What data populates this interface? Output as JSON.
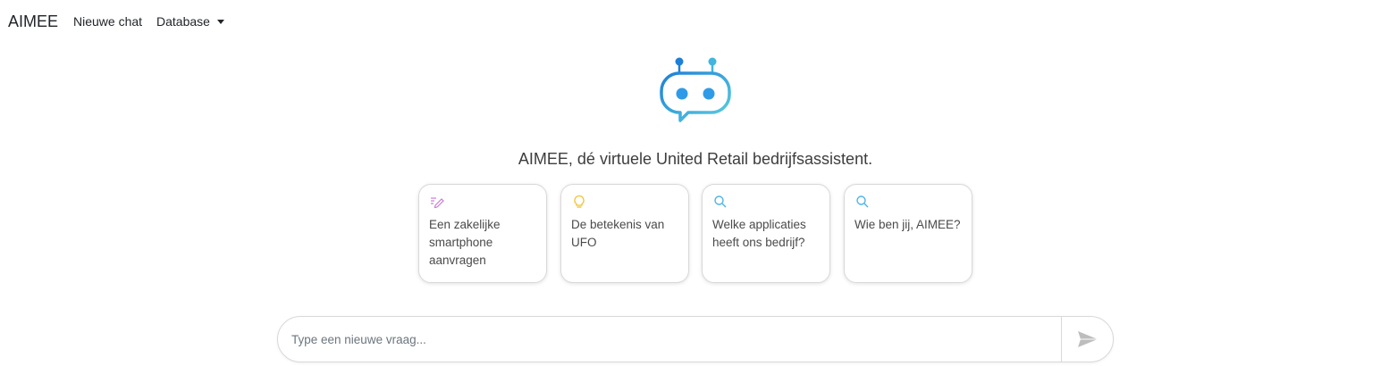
{
  "nav": {
    "brand": "AIMEE",
    "new_chat": "Nieuwe chat",
    "database": "Database"
  },
  "hero": {
    "logo_icon": "robot-chat-bubble-icon",
    "tagline": "AIMEE, dé virtuele United Retail bedrijfsassistent."
  },
  "suggestions": [
    {
      "icon": "pencil-lines-icon",
      "text": "Een zakelijke smartphone aanvragen",
      "color": "#c77dd6"
    },
    {
      "icon": "lightbulb-icon",
      "text": "De betekenis van UFO",
      "color": "#f2c12e"
    },
    {
      "icon": "search-icon",
      "text": "Welke applicaties heeft ons bedrijf?",
      "color": "#4fb3e8"
    },
    {
      "icon": "search-icon",
      "text": "Wie ben jij, AIMEE?",
      "color": "#4fb3e8"
    }
  ],
  "chat": {
    "placeholder": "Type een nieuwe vraag...",
    "value": "",
    "send_icon": "send-icon"
  },
  "colors": {
    "logo_gradient_start": "#1e7fd6",
    "logo_gradient_end": "#5ad0e0",
    "send_icon": "#bdbdbd"
  }
}
